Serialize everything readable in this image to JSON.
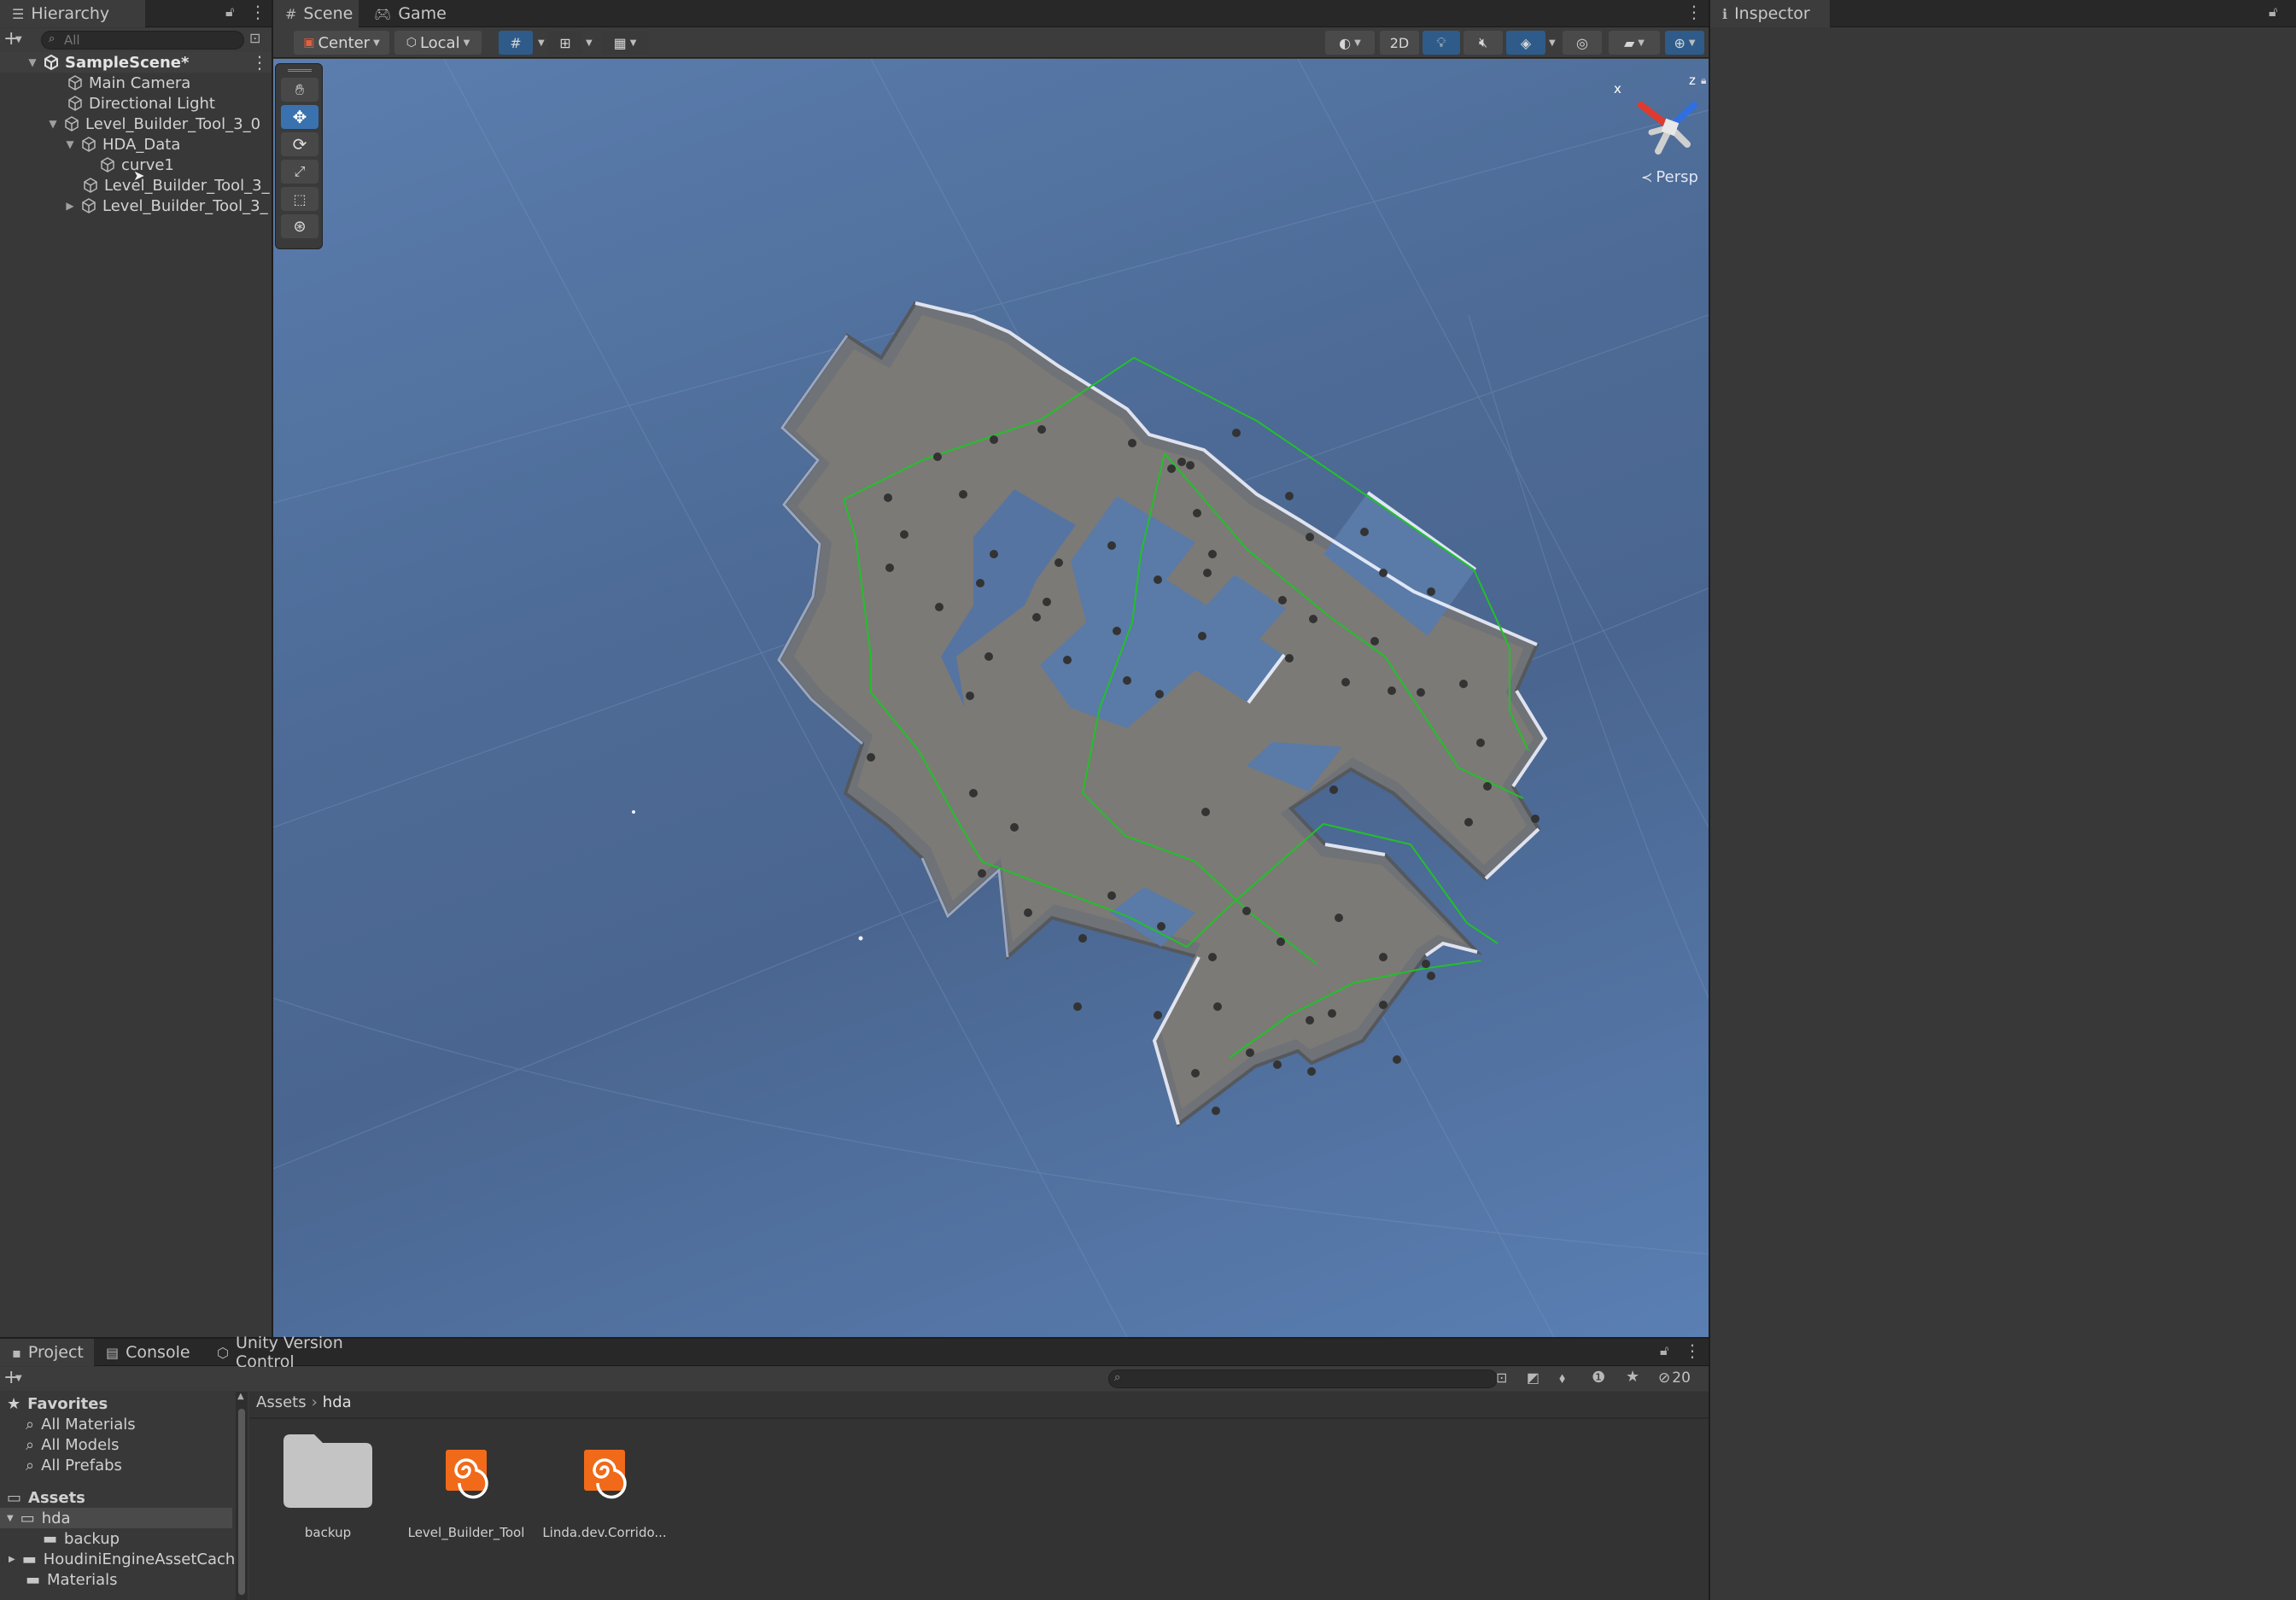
{
  "hierarchy": {
    "tab_label": "Hierarchy",
    "search_placeholder": "All",
    "scene_name": "SampleScene*",
    "items": [
      {
        "label": "Main Camera"
      },
      {
        "label": "Directional Light"
      },
      {
        "label": "Level_Builder_Tool_3_0"
      },
      {
        "label": "HDA_Data"
      },
      {
        "label": "curve1"
      },
      {
        "label": "Level_Builder_Tool_3_"
      },
      {
        "label": "Level_Builder_Tool_3_"
      }
    ]
  },
  "scene_view": {
    "tabs": [
      {
        "label": "Scene"
      },
      {
        "label": "Game"
      }
    ],
    "pivot_mode": "Center",
    "pivot_rotation": "Local",
    "mode_2d": "2D",
    "gizmo_x": "x",
    "gizmo_z": "z",
    "projection_label": "Persp"
  },
  "inspector": {
    "tab_label": "Inspector"
  },
  "bottom_panel": {
    "tabs": [
      {
        "label": "Project"
      },
      {
        "label": "Console"
      },
      {
        "label": "Unity Version Control"
      }
    ],
    "hidden_count": "20",
    "favorites": {
      "header": "Favorites",
      "items": [
        {
          "label": "All Materials"
        },
        {
          "label": "All Models"
        },
        {
          "label": "All Prefabs"
        }
      ]
    },
    "assets": {
      "header": "Assets",
      "folders": [
        {
          "label": "hda"
        },
        {
          "label": "backup"
        },
        {
          "label": "HoudiniEngineAssetCach"
        },
        {
          "label": "Materials"
        }
      ]
    },
    "breadcrumb": [
      "Assets",
      "hda"
    ],
    "grid_items": [
      {
        "label": "backup",
        "icon": "folder-icon"
      },
      {
        "label": "Level_Builder_Tool",
        "icon": "houdini-icon"
      },
      {
        "label": "Linda.dev.Corrido...",
        "icon": "houdini-icon"
      }
    ]
  },
  "colors": {
    "accent": "#3a72b0",
    "houdini": "#f06a1a",
    "curve": "#22c02a"
  }
}
